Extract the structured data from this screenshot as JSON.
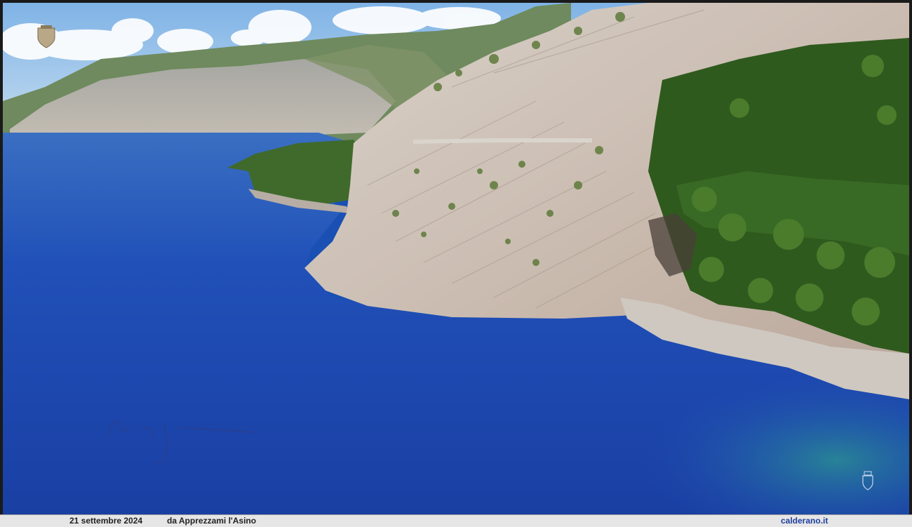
{
  "photo": {
    "subject": "aerial view of rocky coastline"
  },
  "caption": {
    "date": "21 settembre 2024",
    "place": "da Apprezzami l'Asino",
    "site": "calderano.it"
  },
  "colors": {
    "sea_deep": "#1e44a8",
    "sea_mid": "#2a66c4",
    "sea_shallow": "#2f8a9a",
    "rock": "#c9c0b8",
    "vegetation": "#3d6b2a",
    "sky": "#9ec6ea",
    "caption_site": "#1f3f9e"
  }
}
